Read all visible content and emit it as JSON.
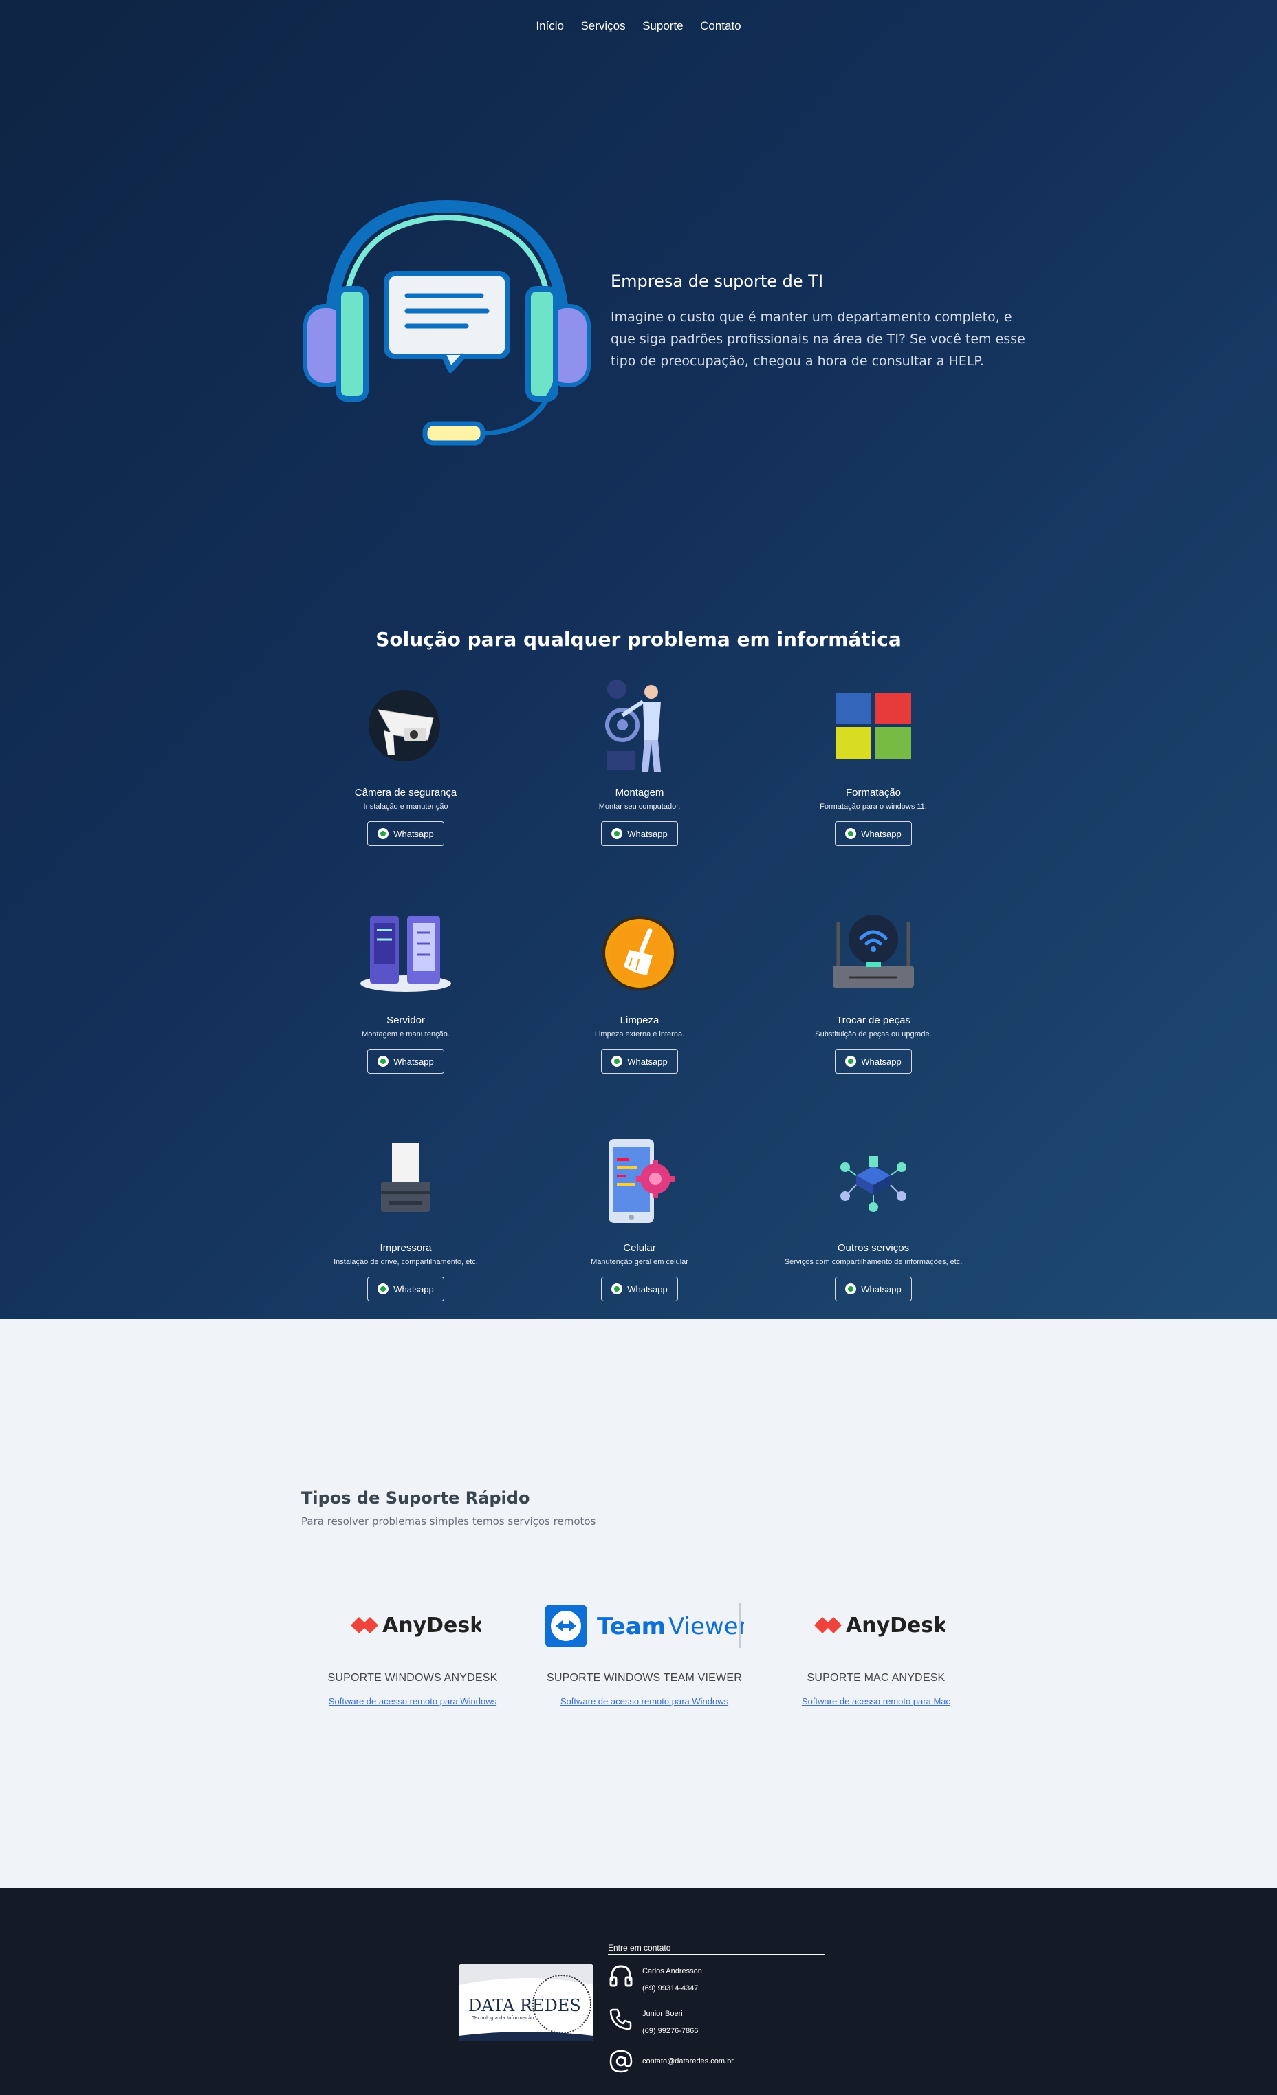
{
  "nav": {
    "items": [
      "Início",
      "Serviços",
      "Suporte",
      "Contato"
    ]
  },
  "hero": {
    "title": "Empresa de suporte de TI",
    "description": "Imagine o custo que é manter um departamento completo, e que siga padrões profissionais na área de TI? Se você tem esse tipo de preocupação, chegou a hora de consultar a HELP."
  },
  "services": {
    "title": "Solução para qualquer problema em informática",
    "items": [
      {
        "name": "Câmera de segurança",
        "desc": "Instalação e manutenção",
        "button": "Whatsapp",
        "icon": "security-camera-icon"
      },
      {
        "name": "Montagem",
        "desc": "Montar seu computador.",
        "button": "Whatsapp",
        "icon": "assembly-illustration"
      },
      {
        "name": "Formatação",
        "desc": "Formatação para o windows 11.",
        "button": "Whatsapp",
        "icon": "windows-logo-icon"
      },
      {
        "name": "Servidor",
        "desc": "Montagem e manutenção.",
        "button": "Whatsapp",
        "icon": "server-icon"
      },
      {
        "name": "Limpeza",
        "desc": "Limpeza externa e interna.",
        "button": "Whatsapp",
        "icon": "broom-icon"
      },
      {
        "name": "Trocar de peças",
        "desc": "Substituição de peças ou upgrade.",
        "button": "Whatsapp",
        "icon": "router-icon"
      },
      {
        "name": "Impressora",
        "desc": "Instalação de drive, compartilhamento, etc.",
        "button": "Whatsapp",
        "icon": "printer-icon"
      },
      {
        "name": "Celular",
        "desc": "Manutenção geral em celular",
        "button": "Whatsapp",
        "icon": "phone-gear-icon"
      },
      {
        "name": "Outros serviços",
        "desc": "Serviços com compartilhamento de informações, etc.",
        "button": "Whatsapp",
        "icon": "network-icon"
      }
    ]
  },
  "support": {
    "title": "Tipos de Suporte Rápido",
    "subtitle": "Para resolver problemas simples temos serviços remotos",
    "items": [
      {
        "logo": "AnyDesk",
        "name": "SUPORTE WINDOWS ANYDESK",
        "link": "Software de acesso remoto para Windows"
      },
      {
        "logo": "TeamViewer",
        "name": "SUPORTE WINDOWS TEAM VIEWER",
        "link": "Software de acesso remoto para Windows"
      },
      {
        "logo": "AnyDesk",
        "name": "SUPORTE MAC ANYDESK",
        "link": "Software de acesso remoto para Mac"
      }
    ]
  },
  "footer": {
    "logo_text": "DATA REDES",
    "logo_sub": "Tecnologia da Informação",
    "contact_heading": "Entre em contato",
    "contacts": [
      {
        "name": "Carlos Andresson",
        "phone": "(69) 99314-4347"
      },
      {
        "name": "Junior Boeri",
        "phone": "(69) 99276-7866"
      }
    ],
    "email": "contato@dataredes.com.br"
  },
  "colors": {
    "dark_bg": "#13305a",
    "footer_bg": "#141a26",
    "link": "#3a6fd0",
    "anydesk_red": "#ef443b",
    "teamviewer_blue": "#0e6fd6"
  }
}
